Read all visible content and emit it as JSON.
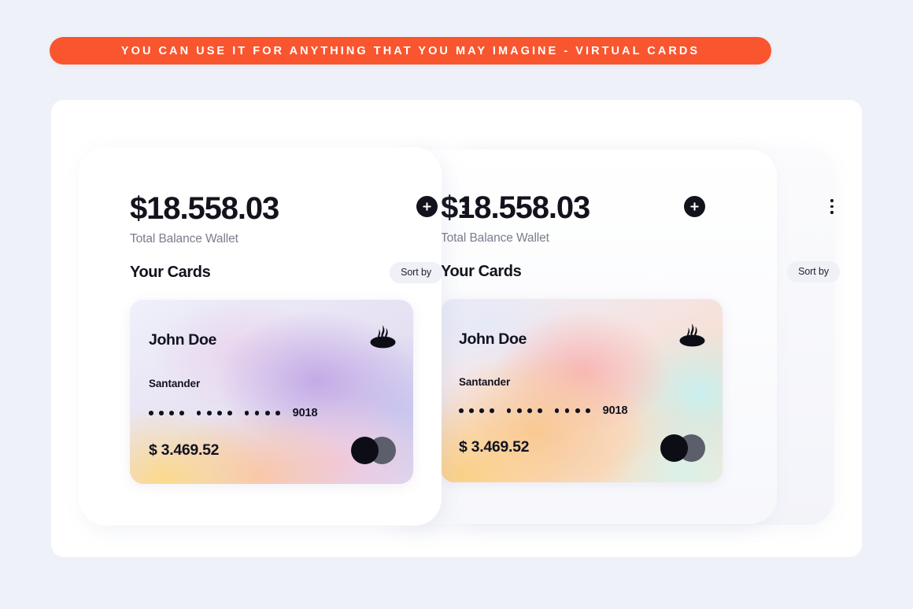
{
  "banner": {
    "text": "YOU CAN USE IT FOR ANYTHING THAT YOU MAY IMAGINE - VIRTUAL CARDS",
    "bg_color": "#f9552e",
    "text_color": "#ffffff"
  },
  "page": {
    "background_color": "#eff1f9",
    "stage_color": "#ffffff"
  },
  "panels": [
    {
      "id": "front",
      "balance": "$18.558.03",
      "balance_label": "Total Balance Wallet",
      "add_icon": "plus-icon",
      "menu_icon": "kebab-menu-icon",
      "section_title": "Your Cards",
      "sort_label": "Sort by",
      "card": {
        "holder": "John Doe",
        "bank": "Santander",
        "bank_logo_icon": "santander-flame-icon",
        "masked_groups": [
          "••••",
          "••••",
          "••••"
        ],
        "last4": "9018",
        "amount": "$ 3.469.52",
        "network_icon": "mastercard-icon",
        "gradient": "lavender-purple-pink"
      }
    },
    {
      "id": "mid",
      "balance": "$18.558.03",
      "balance_label": "Total Balance Wallet",
      "add_icon": "plus-icon",
      "menu_icon": "kebab-menu-icon",
      "section_title": "Your Cards",
      "sort_label": "Sort by",
      "card": {
        "holder": "John Doe",
        "bank": "Santander",
        "bank_logo_icon": "santander-flame-icon",
        "masked_groups": [
          "••••",
          "••••",
          "••••"
        ],
        "last4": "9018",
        "amount": "$ 3.469.52",
        "network_icon": "mastercard-icon",
        "gradient": "orange-peach-cyan"
      }
    }
  ]
}
